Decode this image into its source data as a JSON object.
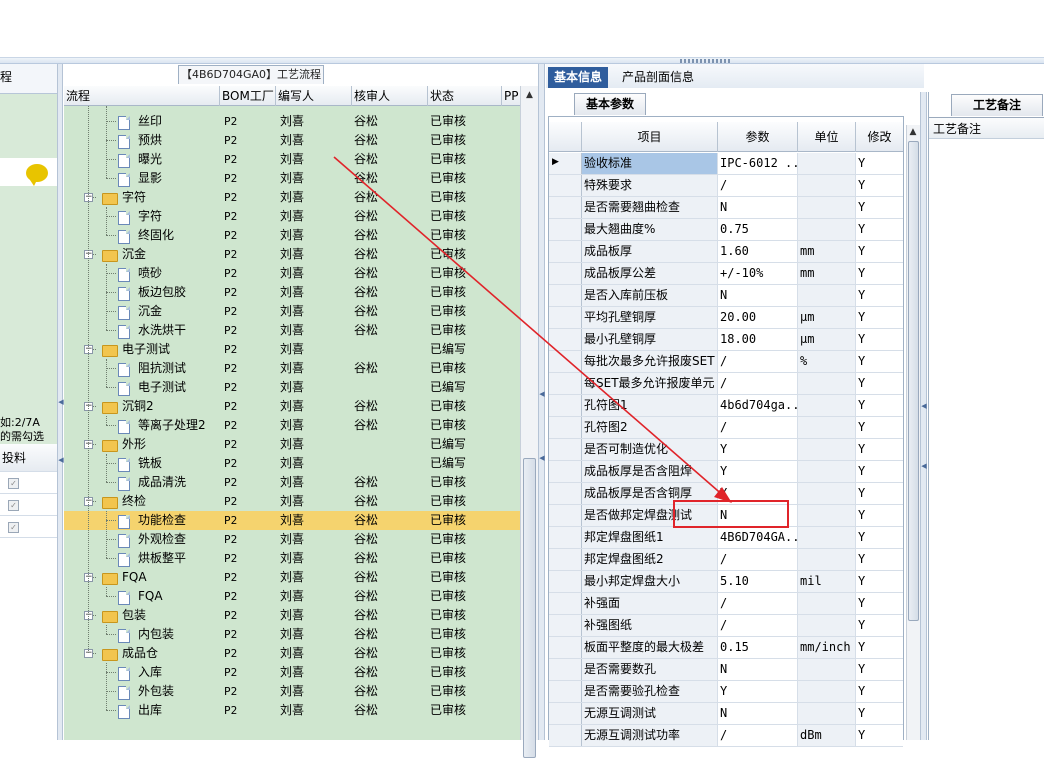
{
  "left_panel": {
    "hint_line1": "如:2/7A",
    "hint_line2": "的需勾选",
    "col_label": "投料"
  },
  "center": {
    "caption": "【4B6D704GA0】工艺流程",
    "headers": [
      "流程",
      "BOM工厂",
      "编写人",
      "核审人",
      "状态",
      "PP"
    ],
    "rows": [
      {
        "level": 1,
        "kind": "file",
        "name": "丝印",
        "bom": "P2",
        "writer": "刘喜",
        "reviewer": "谷松",
        "status": "已审核"
      },
      {
        "level": 1,
        "kind": "file",
        "name": "预烘",
        "bom": "P2",
        "writer": "刘喜",
        "reviewer": "谷松",
        "status": "已审核"
      },
      {
        "level": 1,
        "kind": "file",
        "name": "曝光",
        "bom": "P2",
        "writer": "刘喜",
        "reviewer": "谷松",
        "status": "已审核"
      },
      {
        "level": 1,
        "kind": "file",
        "name": "显影",
        "bom": "P2",
        "writer": "刘喜",
        "reviewer": "谷松",
        "status": "已审核"
      },
      {
        "level": 0,
        "kind": "folder",
        "name": "字符",
        "bom": "P2",
        "writer": "刘喜",
        "reviewer": "谷松",
        "status": "已审核"
      },
      {
        "level": 1,
        "kind": "file",
        "name": "字符",
        "bom": "P2",
        "writer": "刘喜",
        "reviewer": "谷松",
        "status": "已审核"
      },
      {
        "level": 1,
        "kind": "file",
        "name": "终固化",
        "bom": "P2",
        "writer": "刘喜",
        "reviewer": "谷松",
        "status": "已审核"
      },
      {
        "level": 0,
        "kind": "folder",
        "name": "沉金",
        "bom": "P2",
        "writer": "刘喜",
        "reviewer": "谷松",
        "status": "已审核"
      },
      {
        "level": 1,
        "kind": "file",
        "name": "喷砂",
        "bom": "P2",
        "writer": "刘喜",
        "reviewer": "谷松",
        "status": "已审核"
      },
      {
        "level": 1,
        "kind": "file",
        "name": "板边包胶",
        "bom": "P2",
        "writer": "刘喜",
        "reviewer": "谷松",
        "status": "已审核"
      },
      {
        "level": 1,
        "kind": "file",
        "name": "沉金",
        "bom": "P2",
        "writer": "刘喜",
        "reviewer": "谷松",
        "status": "已审核"
      },
      {
        "level": 1,
        "kind": "file",
        "name": "水洗烘干",
        "bom": "P2",
        "writer": "刘喜",
        "reviewer": "谷松",
        "status": "已审核"
      },
      {
        "level": 0,
        "kind": "folder",
        "name": "电子测试",
        "bom": "P2",
        "writer": "刘喜",
        "reviewer": "",
        "status": "已编写"
      },
      {
        "level": 1,
        "kind": "file",
        "name": "阻抗测试",
        "bom": "P2",
        "writer": "刘喜",
        "reviewer": "谷松",
        "status": "已审核"
      },
      {
        "level": 1,
        "kind": "file",
        "name": "电子测试",
        "bom": "P2",
        "writer": "刘喜",
        "reviewer": "",
        "status": "已编写"
      },
      {
        "level": 0,
        "kind": "folder",
        "name": "沉铜2",
        "bom": "P2",
        "writer": "刘喜",
        "reviewer": "谷松",
        "status": "已审核"
      },
      {
        "level": 1,
        "kind": "file",
        "name": "等离子处理2",
        "bom": "P2",
        "writer": "刘喜",
        "reviewer": "谷松",
        "status": "已审核"
      },
      {
        "level": 0,
        "kind": "folder",
        "name": "外形",
        "bom": "P2",
        "writer": "刘喜",
        "reviewer": "",
        "status": "已编写"
      },
      {
        "level": 1,
        "kind": "file",
        "name": "铣板",
        "bom": "P2",
        "writer": "刘喜",
        "reviewer": "",
        "status": "已编写"
      },
      {
        "level": 1,
        "kind": "file",
        "name": "成品清洗",
        "bom": "P2",
        "writer": "刘喜",
        "reviewer": "谷松",
        "status": "已审核"
      },
      {
        "level": 0,
        "kind": "folder",
        "name": "终检",
        "bom": "P2",
        "writer": "刘喜",
        "reviewer": "谷松",
        "status": "已审核"
      },
      {
        "level": 1,
        "kind": "file",
        "name": "功能检查",
        "bom": "P2",
        "writer": "刘喜",
        "reviewer": "谷松",
        "status": "已审核",
        "selected": true
      },
      {
        "level": 1,
        "kind": "file",
        "name": "外观检查",
        "bom": "P2",
        "writer": "刘喜",
        "reviewer": "谷松",
        "status": "已审核"
      },
      {
        "level": 1,
        "kind": "file",
        "name": "烘板整平",
        "bom": "P2",
        "writer": "刘喜",
        "reviewer": "谷松",
        "status": "已审核"
      },
      {
        "level": 0,
        "kind": "folder",
        "name": "FQA",
        "bom": "P2",
        "writer": "刘喜",
        "reviewer": "谷松",
        "status": "已审核"
      },
      {
        "level": 1,
        "kind": "file",
        "name": "FQA",
        "bom": "P2",
        "writer": "刘喜",
        "reviewer": "谷松",
        "status": "已审核"
      },
      {
        "level": 0,
        "kind": "folder",
        "name": "包装",
        "bom": "P2",
        "writer": "刘喜",
        "reviewer": "谷松",
        "status": "已审核"
      },
      {
        "level": 1,
        "kind": "file",
        "name": "内包装",
        "bom": "P2",
        "writer": "刘喜",
        "reviewer": "谷松",
        "status": "已审核"
      },
      {
        "level": 0,
        "kind": "folder",
        "name": "成品仓",
        "bom": "P2",
        "writer": "刘喜",
        "reviewer": "谷松",
        "status": "已审核"
      },
      {
        "level": 1,
        "kind": "file",
        "name": "入库",
        "bom": "P2",
        "writer": "刘喜",
        "reviewer": "谷松",
        "status": "已审核"
      },
      {
        "level": 1,
        "kind": "file",
        "name": "外包装",
        "bom": "P2",
        "writer": "刘喜",
        "reviewer": "谷松",
        "status": "已审核"
      },
      {
        "level": 1,
        "kind": "file",
        "name": "出库",
        "bom": "P2",
        "writer": "刘喜",
        "reviewer": "谷松",
        "status": "已审核"
      }
    ]
  },
  "right": {
    "tabs": [
      "基本信息",
      "产品剖面信息"
    ],
    "subtab": "基本参数",
    "headers": [
      "项目",
      "参数",
      "单位",
      "修改"
    ],
    "rows": [
      {
        "item": "验收标准",
        "param": "IPC-6012 ...",
        "unit": "",
        "mod": "Y",
        "current": true
      },
      {
        "item": "特殊要求",
        "param": "/",
        "unit": "",
        "mod": "Y"
      },
      {
        "item": "是否需要翘曲检查",
        "param": "N",
        "unit": "",
        "mod": "Y"
      },
      {
        "item": "最大翘曲度%",
        "param": "0.75",
        "unit": "",
        "mod": "Y"
      },
      {
        "item": "成品板厚",
        "param": "1.60",
        "unit": "mm",
        "mod": "Y"
      },
      {
        "item": "成品板厚公差",
        "param": "+/-10%",
        "unit": "mm",
        "mod": "Y"
      },
      {
        "item": "是否入库前压板",
        "param": "N",
        "unit": "",
        "mod": "Y"
      },
      {
        "item": "平均孔壁铜厚",
        "param": "20.00",
        "unit": "μm",
        "mod": "Y"
      },
      {
        "item": "最小孔壁铜厚",
        "param": "18.00",
        "unit": "μm",
        "mod": "Y"
      },
      {
        "item": "每批次最多允许报废SET",
        "param": "/",
        "unit": "%",
        "mod": "Y"
      },
      {
        "item": "每SET最多允许报废单元",
        "param": "/",
        "unit": "",
        "mod": "Y"
      },
      {
        "item": "孔符图1",
        "param": "4b6d704ga...",
        "unit": "",
        "mod": "Y"
      },
      {
        "item": "孔符图2",
        "param": "/",
        "unit": "",
        "mod": "Y"
      },
      {
        "item": "是否可制造优化",
        "param": "Y",
        "unit": "",
        "mod": "Y"
      },
      {
        "item": "成品板厚是否含阻焊",
        "param": "Y",
        "unit": "",
        "mod": "Y"
      },
      {
        "item": "成品板厚是否含铜厚",
        "param": "Y",
        "unit": "",
        "mod": "Y"
      },
      {
        "item": "是否做邦定焊盘测试",
        "param": "N",
        "unit": "",
        "mod": "Y",
        "highlight": true
      },
      {
        "item": "邦定焊盘图纸1",
        "param": "4B6D704GA...",
        "unit": "",
        "mod": "Y"
      },
      {
        "item": "邦定焊盘图纸2",
        "param": "/",
        "unit": "",
        "mod": "Y"
      },
      {
        "item": "最小邦定焊盘大小",
        "param": "5.10",
        "unit": "mil",
        "mod": "Y"
      },
      {
        "item": "补强面",
        "param": "/",
        "unit": "",
        "mod": "Y"
      },
      {
        "item": "补强图纸",
        "param": "/",
        "unit": "",
        "mod": "Y"
      },
      {
        "item": "板面平整度的最大极差",
        "param": "0.15",
        "unit": "mm/inch",
        "mod": "Y"
      },
      {
        "item": "是否需要数孔",
        "param": "N",
        "unit": "",
        "mod": "Y"
      },
      {
        "item": "是否需要验孔检查",
        "param": "Y",
        "unit": "",
        "mod": "Y"
      },
      {
        "item": "无源互调测试",
        "param": "N",
        "unit": "",
        "mod": "Y"
      },
      {
        "item": "无源互调测试功率",
        "param": "/",
        "unit": "dBm",
        "mod": "Y"
      }
    ]
  },
  "notes_panel": {
    "tab": "工艺备注",
    "header": "工艺备注"
  },
  "colors": {
    "tree_bg": "#cfe6cf",
    "selected_row": "#f5d36e",
    "tab_active": "#2f5d9d",
    "annotation_red": "#e0242a"
  }
}
